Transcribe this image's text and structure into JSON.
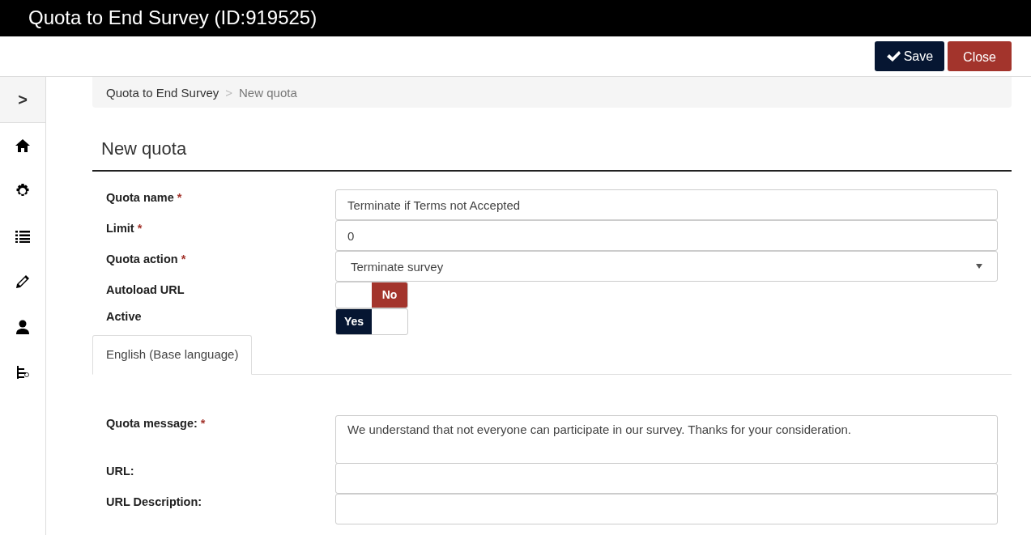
{
  "window": {
    "title": "Quota to End Survey (ID:919525)"
  },
  "toolbar": {
    "buttons": [
      {
        "label": "Save",
        "kind": "save"
      },
      {
        "label": "Close",
        "kind": "close"
      }
    ]
  },
  "sidebar": {
    "toggle": ">"
  },
  "breadcrumb": [
    {
      "label": "Quota to End Survey",
      "selected": false
    },
    {
      "label": "New quota",
      "selected": true
    }
  ],
  "breadcrumb_separator": ">",
  "heading": "New quota",
  "fields": [
    {
      "label": "Quota name",
      "required": true,
      "kind": "text",
      "value": "Terminate if Terms not Accepted"
    },
    {
      "label": "Limit",
      "required": true,
      "kind": "text",
      "value": "0"
    },
    {
      "label": "Quota action",
      "required": true,
      "kind": "select",
      "value": "Terminate survey"
    },
    {
      "label": "Autoload URL",
      "required": false,
      "kind": "switch",
      "on": false,
      "state_label": "No"
    },
    {
      "label": "Active",
      "required": false,
      "kind": "switch",
      "on": true,
      "state_label": "Yes"
    }
  ],
  "required_mark": "*",
  "language_tabs": [
    {
      "label": "English (Base language)",
      "selected": true
    }
  ],
  "language_fields": [
    {
      "label": "Quota message:",
      "required": true,
      "kind": "textarea",
      "value": "We understand that not everyone can participate in our survey. Thanks for your consideration."
    },
    {
      "label": "URL:",
      "required": false,
      "kind": "text"
    },
    {
      "label": "URL Description:",
      "required": false,
      "kind": "text"
    }
  ]
}
